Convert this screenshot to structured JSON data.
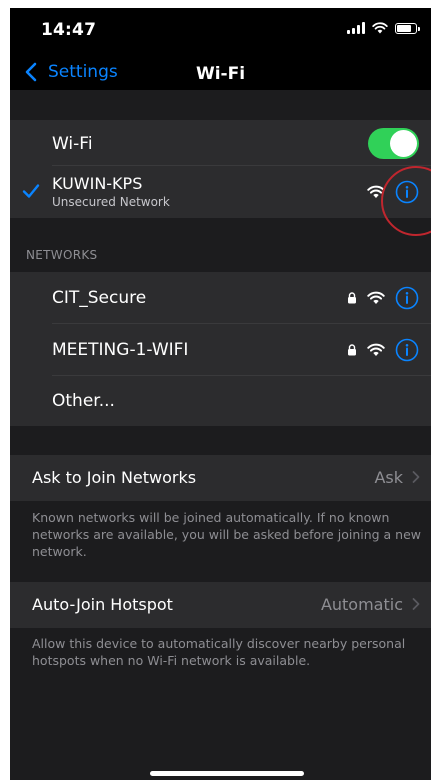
{
  "status_bar": {
    "time": "14:47",
    "icons": [
      "cellular-signal-icon",
      "wifi-icon",
      "battery-icon"
    ]
  },
  "nav": {
    "back_label": "Settings",
    "title": "Wi-Fi"
  },
  "wifi_toggle": {
    "label": "Wi-Fi",
    "on": true
  },
  "connected_network": {
    "name": "KUWIN-KPS",
    "subtitle": "Unsecured Network",
    "icons": [
      "checkmark-icon",
      "wifi-icon",
      "info-icon"
    ]
  },
  "networks_section": {
    "header": "NETWORKS",
    "items": [
      {
        "name": "CIT_Secure",
        "secured": true
      },
      {
        "name": "MEETING-1-WIFI",
        "secured": true
      }
    ],
    "other_label": "Other..."
  },
  "ask_to_join": {
    "label": "Ask to Join Networks",
    "value": "Ask",
    "footer": "Known networks will be joined automatically. If no known networks are available, you will be asked before joining a new network."
  },
  "auto_join": {
    "label": "Auto-Join Hotspot",
    "value": "Automatic",
    "footer": "Allow this device to automatically discover nearby personal hotspots when no Wi-Fi network is available."
  },
  "colors": {
    "accent": "#0a84ff",
    "toggle_on": "#30d158",
    "annotation": "#c0262e"
  }
}
